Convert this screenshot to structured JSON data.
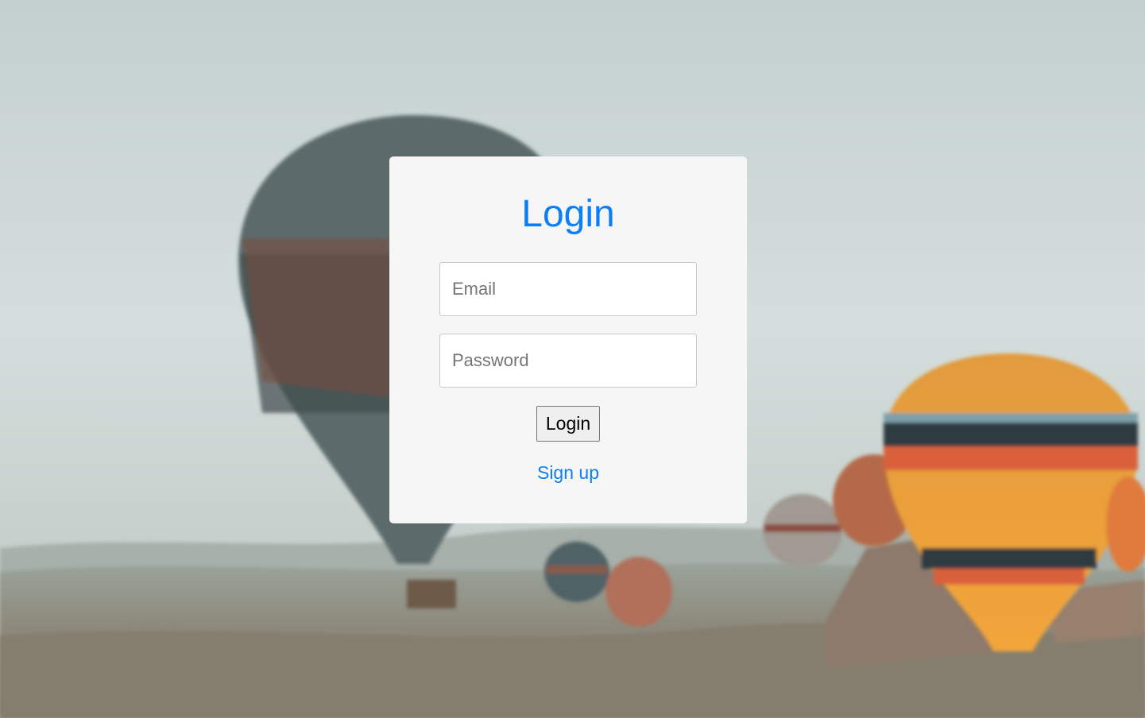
{
  "login_form": {
    "title": "Login",
    "email_placeholder": "Email",
    "password_placeholder": "Password",
    "submit_label": "Login",
    "signup_link_label": "Sign up"
  },
  "colors": {
    "accent": "#0d7ef5",
    "card_background": "#f6f6f6",
    "sky": "#cfd9d8"
  },
  "background": {
    "description_icon": "hot-air-balloons-landscape-image"
  }
}
